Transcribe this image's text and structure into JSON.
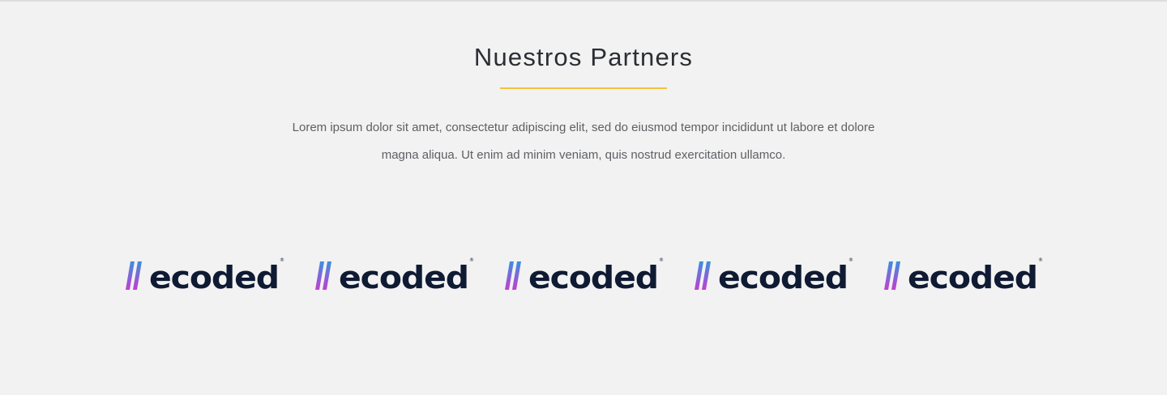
{
  "section": {
    "title": "Nuestros Partners",
    "description": "Lorem ipsum dolor sit amet, consectetur adipiscing elit, sed do eiusmod tempor incididunt ut labore et dolore magna aliqua. Ut enim ad minim veniam, quis nostrud exercitation ullamco.",
    "accent_color": "#f5c23d"
  },
  "partners": [
    {
      "name": "ecoded",
      "mark": "®"
    },
    {
      "name": "ecoded",
      "mark": "®"
    },
    {
      "name": "ecoded",
      "mark": "®"
    },
    {
      "name": "ecoded",
      "mark": "®"
    },
    {
      "name": "ecoded",
      "mark": "®"
    }
  ],
  "colors": {
    "background": "#f2f2f2",
    "title": "#2b2e33",
    "text": "#5d5f63",
    "logo_text": "#0f1a33",
    "logo_gradient_top": "#3b8fe0",
    "logo_gradient_bottom": "#c23fd0"
  }
}
